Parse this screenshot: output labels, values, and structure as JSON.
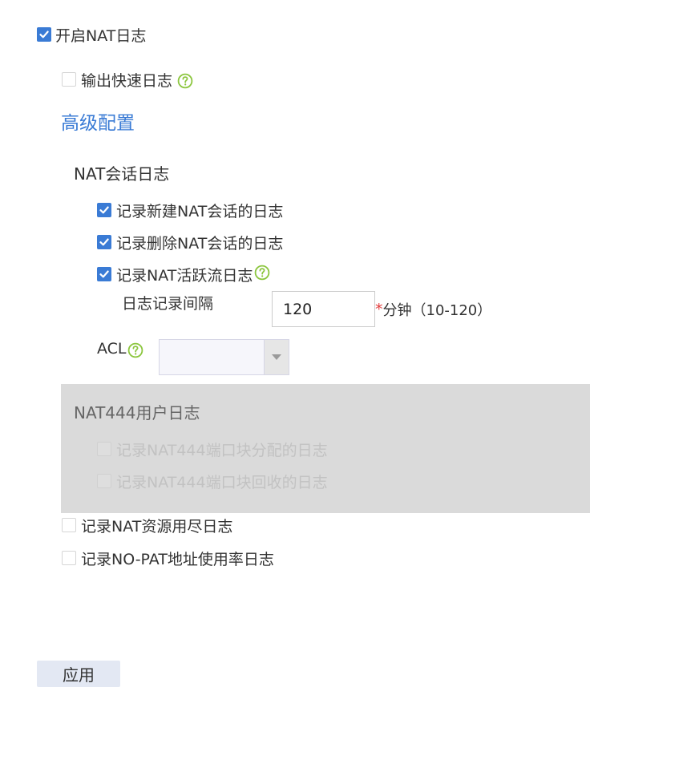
{
  "nat_log": {
    "enable": {
      "label": "开启NAT日志",
      "checked": true
    },
    "fast_output": {
      "label": "输出快速日志",
      "checked": false
    }
  },
  "advanced": {
    "title": "高级配置",
    "session_log": {
      "heading": "NAT会话日志",
      "new_session": {
        "label": "记录新建NAT会话的日志",
        "checked": true
      },
      "delete_session": {
        "label": "记录删除NAT会话的日志",
        "checked": true
      },
      "active_flow": {
        "label": "记录NAT活跃流日志",
        "checked": true
      },
      "interval": {
        "label": "日志记录间隔",
        "value": "120",
        "required_mark": "*",
        "unit_hint": "分钟（10-120）"
      },
      "acl": {
        "label": "ACL",
        "selected": ""
      }
    },
    "nat444_log": {
      "heading": "NAT444用户日志",
      "port_block_alloc": {
        "label": "记录NAT444端口块分配的日志",
        "checked": false
      },
      "port_block_reclaim": {
        "label": "记录NAT444端口块回收的日志",
        "checked": false
      }
    },
    "resource_exhausted": {
      "label": "记录NAT资源用尽日志",
      "checked": false
    },
    "nopat_usage": {
      "label": "记录NO-PAT地址使用率日志",
      "checked": false
    }
  },
  "actions": {
    "apply_label": "应用"
  },
  "icons": {
    "checkmark": "checkmark-icon",
    "help": "question-circle-icon",
    "dropdown": "caret-down-icon"
  },
  "colors": {
    "accent": "#3a7bd5",
    "help_icon": "#8cc63f",
    "required": "#e23b3b",
    "disabled_panel": "#dadada",
    "apply_button": "#e3e8f3"
  }
}
